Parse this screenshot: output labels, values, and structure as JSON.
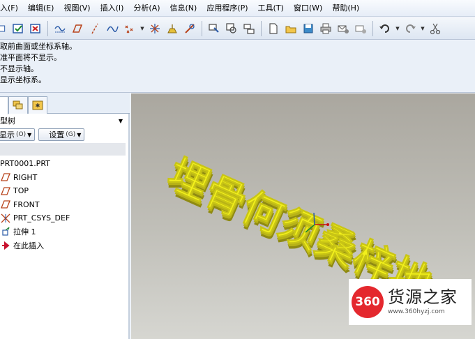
{
  "menu": {
    "items": [
      "入(F)",
      "编辑(E)",
      "视图(V)",
      "插入(I)",
      "分析(A)",
      "信息(N)",
      "应用程序(P)",
      "工具(T)",
      "窗口(W)",
      "帮助(H)"
    ]
  },
  "toolbar": {
    "icons": [
      "redraw-icon",
      "repaint-icon",
      "close-window-icon",
      "datum-plane-display-icon",
      "datum-axis-display-icon",
      "datum-curve-display-icon",
      "datum-point-display-icon",
      "csys-display-icon",
      "annotation-display-icon",
      "spin-center-icon",
      "orient-icon",
      "saved-views-icon",
      "layers-icon",
      "new-file-icon",
      "open-file-icon",
      "save-icon",
      "print-icon",
      "email-icon",
      "email-link-icon",
      "undo-icon",
      "redo-icon",
      "cut-icon"
    ]
  },
  "messages": [
    "取前曲面或坐标系轴。",
    "准平面将不显示。",
    "不显示轴。",
    "显示坐标系。"
  ],
  "model_tree": {
    "title": "型树",
    "show_label": "显示",
    "show_key": "(O)",
    "settings_label": "设置",
    "settings_key": "(G)",
    "items": [
      {
        "label": "PRT0001.PRT",
        "icon": "part-icon"
      },
      {
        "label": "RIGHT",
        "icon": "datum-plane-icon"
      },
      {
        "label": "TOP",
        "icon": "datum-plane-icon"
      },
      {
        "label": "FRONT",
        "icon": "datum-plane-icon"
      },
      {
        "label": "PRT_CSYS_DEF",
        "icon": "csys-icon"
      },
      {
        "label": "拉伸 1",
        "icon": "extrude-icon"
      },
      {
        "label": "在此插入",
        "icon": "insert-arrow-icon"
      }
    ]
  },
  "viewport": {
    "model_text": "埋骨何须桑梓地",
    "model_color": "#f2f01c",
    "background_top": "#aaa79f",
    "background_bottom": "#d6d6d1"
  },
  "watermark": {
    "logo_text": "360",
    "name": "货源之家",
    "url": "www.360hyzj.com",
    "logo_color": "#e4282e"
  }
}
